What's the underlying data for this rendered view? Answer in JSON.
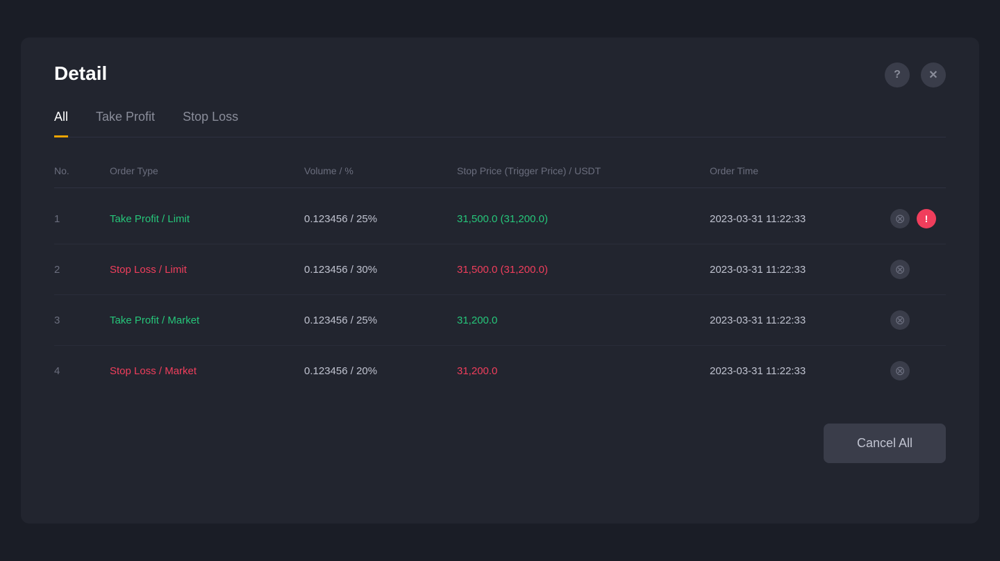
{
  "modal": {
    "title": "Detail",
    "help_icon": "?",
    "close_icon": "✕"
  },
  "tabs": [
    {
      "id": "all",
      "label": "All",
      "active": true
    },
    {
      "id": "take-profit",
      "label": "Take Profit",
      "active": false
    },
    {
      "id": "stop-loss",
      "label": "Stop Loss",
      "active": false
    }
  ],
  "table": {
    "headers": {
      "no": "No.",
      "order_type": "Order Type",
      "volume": "Volume / %",
      "stop_price": "Stop Price (Trigger Price) / USDT",
      "order_time": "Order Time"
    },
    "rows": [
      {
        "no": "1",
        "order_type": "Take Profit / Limit",
        "order_type_color": "green",
        "volume": "0.123456 / 25%",
        "stop_price": "31,500.0 (31,200.0)",
        "stop_price_color": "green",
        "order_time": "2023-03-31 11:22:33",
        "has_warning": true
      },
      {
        "no": "2",
        "order_type": "Stop Loss / Limit",
        "order_type_color": "red",
        "volume": "0.123456 / 30%",
        "stop_price": "31,500.0 (31,200.0)",
        "stop_price_color": "red",
        "order_time": "2023-03-31 11:22:33",
        "has_warning": false
      },
      {
        "no": "3",
        "order_type": "Take Profit / Market",
        "order_type_color": "green",
        "volume": "0.123456 / 25%",
        "stop_price": "31,200.0",
        "stop_price_color": "green",
        "order_time": "2023-03-31 11:22:33",
        "has_warning": false
      },
      {
        "no": "4",
        "order_type": "Stop Loss / Market",
        "order_type_color": "red",
        "volume": "0.123456 / 20%",
        "stop_price": "31,200.0",
        "stop_price_color": "red",
        "order_time": "2023-03-31 11:22:33",
        "has_warning": false
      }
    ]
  },
  "footer": {
    "cancel_all_label": "Cancel All"
  }
}
